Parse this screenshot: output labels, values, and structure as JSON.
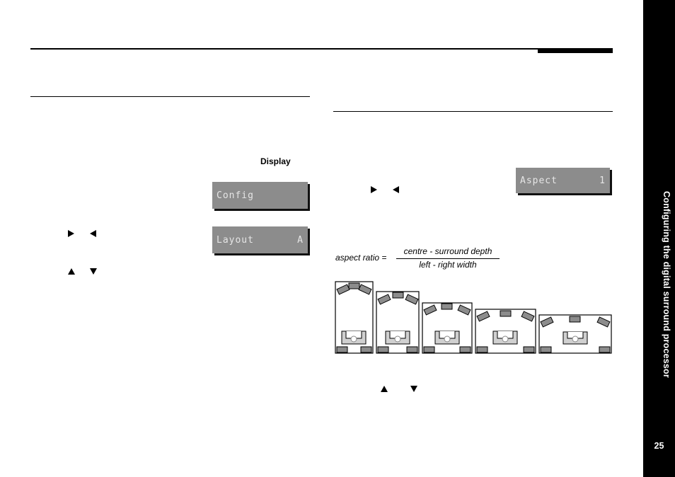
{
  "page": {
    "side_title": "Configuring the digital surround processor",
    "page_number": "25"
  },
  "left_column": {
    "display_label": "Display",
    "lcd_screens": [
      {
        "left": "Config",
        "right": ""
      },
      {
        "left": "Layout",
        "right": "A"
      }
    ],
    "arrow_icons": [
      "right-arrow-icon",
      "left-arrow-icon",
      "up-arrow-icon",
      "down-arrow-icon"
    ]
  },
  "right_column": {
    "lcd_screen": {
      "left": "Aspect",
      "right": "1"
    },
    "formula": {
      "lhs": "aspect ratio =",
      "numerator": "centre - surround depth",
      "denominator": "left - right width"
    },
    "room_diagrams": [
      {
        "aspect": "deep"
      },
      {
        "aspect": "medium-deep"
      },
      {
        "aspect": "medium"
      },
      {
        "aspect": "medium-wide"
      },
      {
        "aspect": "wide"
      }
    ],
    "arrow_icons": [
      "right-arrow-icon",
      "left-arrow-icon",
      "up-arrow-icon",
      "down-arrow-icon"
    ]
  }
}
